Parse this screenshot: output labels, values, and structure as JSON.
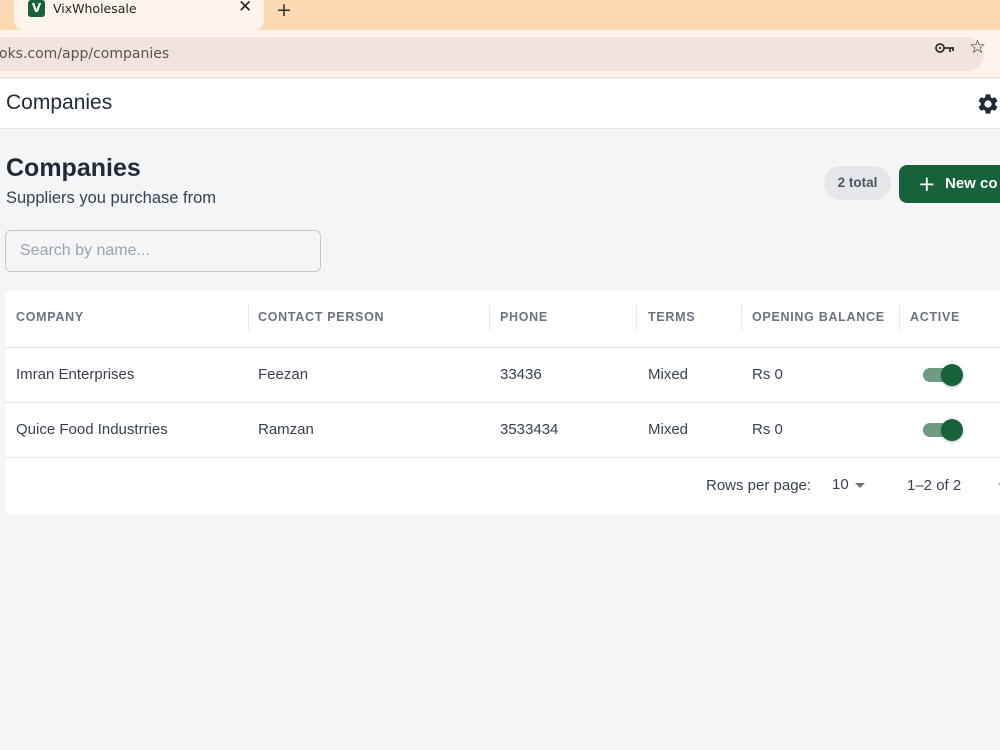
{
  "browser": {
    "tab_title": "VixWholesale",
    "favicon_letter": "V",
    "url": "oks.com/app/companies"
  },
  "appbar": {
    "title": "Companies"
  },
  "page": {
    "title": "Companies",
    "subtitle": "Suppliers you purchase from",
    "count_badge": "2 total",
    "new_button_label": "New co"
  },
  "search": {
    "placeholder": "Search by name...",
    "value": ""
  },
  "table": {
    "columns": [
      "COMPANY",
      "CONTACT PERSON",
      "PHONE",
      "TERMS",
      "OPENING BALANCE",
      "ACTIVE"
    ],
    "rows": [
      {
        "company": "Imran Enterprises",
        "contact": "Feezan",
        "phone": "33436",
        "terms": "Mixed",
        "opening_balance": "Rs 0",
        "active": true
      },
      {
        "company": "Quice Food Industrries",
        "contact": "Ramzan",
        "phone": "3533434",
        "terms": "Mixed",
        "opening_balance": "Rs 0",
        "active": true
      }
    ]
  },
  "pagination": {
    "rows_per_page_label": "Rows per page:",
    "rows_per_page": "10",
    "range": "1–2 of 2"
  },
  "colors": {
    "brand": "#17623a",
    "tabstrip": "#fcd9b3"
  },
  "icons": [
    "close-icon",
    "new-tab-icon",
    "key-icon",
    "star-icon",
    "gear-icon",
    "plus-icon",
    "caret-down-icon"
  ]
}
